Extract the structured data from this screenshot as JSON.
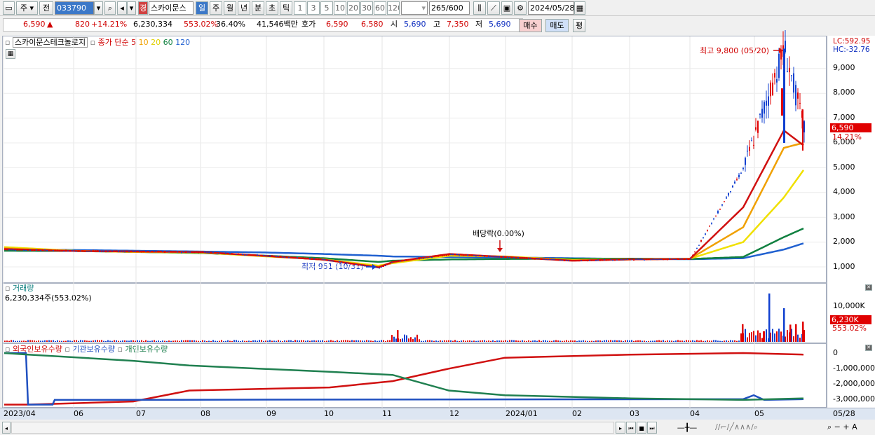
{
  "toolbar": {
    "type_btn": "주",
    "ctrl_btn": "전",
    "code": "033790",
    "name_tag": "경",
    "name": "스카이문스",
    "periods": [
      "일",
      "주",
      "월",
      "년",
      "분",
      "초",
      "틱"
    ],
    "nums": [
      "1",
      "3",
      "5",
      "10",
      "20",
      "30",
      "60",
      "120"
    ],
    "count": "265",
    "total": "/600",
    "date": "2024/05/28"
  },
  "quote": {
    "price": "6,590",
    "arrow": "▲",
    "change": "820",
    "rate": "+14.21%",
    "volume": "6,230,334",
    "vol_ratio": "553.02%",
    "turnover": "36.40%",
    "amount": "41,546백만",
    "hoga_label": "호가",
    "ask": "6,590",
    "bid": "6,580",
    "open_label": "시",
    "open": "5,690",
    "high_label": "고",
    "high": "7,350",
    "low_label": "저",
    "low": "5,690",
    "buy": "매수",
    "sell": "매도",
    "eval": "평"
  },
  "price_pane": {
    "title": "스카이문스테크놀로지",
    "ma_label": "종가 단순",
    "ma_periods": [
      {
        "label": "5",
        "color": "#d01010"
      },
      {
        "label": "10",
        "color": "#f0a000"
      },
      {
        "label": "20",
        "color": "#f0e000"
      },
      {
        "label": "60",
        "color": "#108040"
      },
      {
        "label": "120",
        "color": "#2060d0"
      }
    ],
    "lc": "LC:592.95",
    "hc": "HC:-32.76",
    "max_note": "최고 9,800 (05/20)",
    "min_note": "최저 951 (10/31)",
    "div_note": "배당락(0.00%)",
    "flag_price": "6,590",
    "flag_rate": "14.21%",
    "ticks": [
      "9,000",
      "8,000",
      "7,000",
      "6,000",
      "5,000",
      "4,000",
      "3,000",
      "2,000",
      "1,000"
    ]
  },
  "volume_pane": {
    "title": "거래량",
    "sub": "6,230,334주(553.02%)",
    "tick": "10,000K",
    "flag": "6,230K",
    "flag_rate": "553.02%"
  },
  "holding_pane": {
    "legend": [
      {
        "label": "외국인보유수량",
        "color": "#d01010"
      },
      {
        "label": "기관보유수량",
        "color": "#2050c0"
      },
      {
        "label": "개인보유수량",
        "color": "#208050"
      }
    ],
    "ticks": [
      "0",
      "-1,000,000",
      "-2,000,000",
      "-3,000,000"
    ]
  },
  "x_axis": {
    "labels": [
      "2023/04",
      "06",
      "07",
      "08",
      "09",
      "10",
      "11",
      "12",
      "2024/01",
      "02",
      "03",
      "04",
      "05"
    ],
    "end": "05/28"
  },
  "chart_data": [
    {
      "type": "line",
      "title": "스카이문스테크놀로지",
      "x": [
        "2023/04",
        "2023/06",
        "2023/07",
        "2023/08",
        "2023/09",
        "2023/10",
        "2023/10/31",
        "2023/11",
        "2023/12",
        "2024/01",
        "2024/02",
        "2024/03",
        "2024/04",
        "2024/05/10",
        "2024/05/20",
        "2024/05/28"
      ],
      "series": [
        {
          "name": "종가",
          "values": [
            1700,
            1650,
            1620,
            1600,
            1450,
            1300,
            951,
            1200,
            1500,
            1400,
            1250,
            1300,
            1320,
            5000,
            9800,
            6590
          ]
        }
      ],
      "ylim": [
        600,
        10200
      ]
    },
    {
      "type": "bar",
      "title": "거래량",
      "ylim": [
        0,
        14000
      ],
      "x": [
        "2023/11",
        "2024/05/10",
        "2024/05/20",
        "2024/05/28"
      ],
      "values": [
        1500,
        8000,
        11500,
        6230
      ]
    },
    {
      "type": "line",
      "series": [
        {
          "name": "외국인보유수량",
          "values": [
            -3300000,
            -3300000,
            -3100000,
            -2400000,
            -2200000,
            -1800000,
            -1000000,
            -300000,
            -100000,
            0,
            -100000
          ]
        },
        {
          "name": "기관보유수량",
          "values": [
            0,
            -3300000,
            -3000000,
            -3000000,
            -3000000,
            -3000000,
            -2900000,
            -2900000,
            -2900000,
            -2800000,
            -2900000
          ]
        },
        {
          "name": "개인보유수량",
          "values": [
            0,
            -100000,
            -500000,
            -800000,
            -1200000,
            -1400000,
            -2400000,
            -2700000,
            -2900000,
            -3000000,
            -2900000
          ]
        }
      ]
    }
  ]
}
